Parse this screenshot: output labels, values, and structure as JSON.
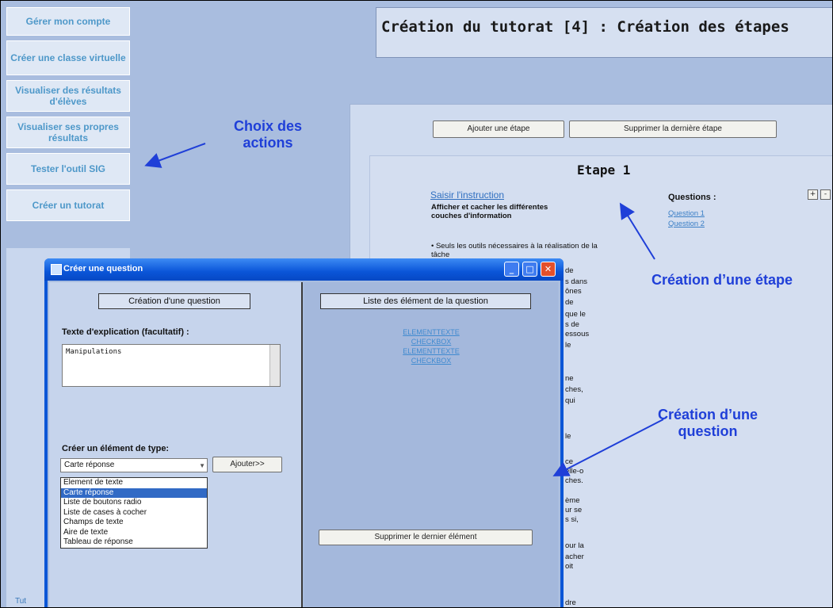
{
  "sidebar": {
    "items": [
      {
        "label": "Gérer mon compte"
      },
      {
        "label": "Créer une classe virtuelle"
      },
      {
        "label": "Visualiser des résultats d'élèves"
      },
      {
        "label": "Visualiser ses propres résultats"
      },
      {
        "label": "Tester l'outil SIG"
      },
      {
        "label": "Créer un tutorat"
      }
    ],
    "footer": "Tut"
  },
  "page": {
    "title": "Création du tutorat [4] : Création des étapes",
    "add_step_button": "Ajouter une étape",
    "delete_step_button": "Supprimer la dernière étape",
    "step_title": "Etape 1",
    "instruction_link": "Saisir l'instruction",
    "instruction_bold": "Afficher et cacher les différentes couches d'information",
    "instruction_bullet": "• Seuls les outils nécessaires à la réalisation de la tâche",
    "questions_title": "Questions :",
    "questions": [
      "Question 1",
      "Question 2"
    ],
    "plus_label": "+",
    "minus_label": "-",
    "fragments": [
      "de",
      "s dans",
      "ônes",
      "de",
      "que le",
      "s de",
      "essous",
      "le",
      "",
      "ne",
      "ches,",
      "qui",
      "",
      "",
      "le",
      "",
      "ce",
      "elle-o",
      "ches.",
      "ème",
      "ur se",
      "s si,",
      "",
      "our la",
      "acher",
      "oit",
      "",
      "dre"
    ]
  },
  "annotations": {
    "actions": "Choix des actions",
    "step": "Création d’une étape",
    "question": "Création d’une question"
  },
  "dialog": {
    "title": "Créer une question",
    "left_header": "Création d'une question",
    "right_header": "Liste des élément de la question",
    "explanation_label": "Texte d'explication (facultatif) :",
    "explanation_value": "Manipulations",
    "create_type_label": "Créer un élément de type:",
    "selected_type": "Carte réponse",
    "add_button": "Ajouter>>",
    "type_options": [
      "Element de texte",
      "Carte réponse",
      "Liste de boutons radio",
      "Liste de cases à cocher",
      "Champs de texte",
      "Aire de texte",
      "Tableau de réponse"
    ],
    "selected_index": 1,
    "elements": [
      "ELEMENTTEXTE",
      "CHECKBOX",
      "ELEMENTTEXTE",
      "CHECKBOX"
    ],
    "delete_last_button": "Supprimer le dernier élément"
  }
}
